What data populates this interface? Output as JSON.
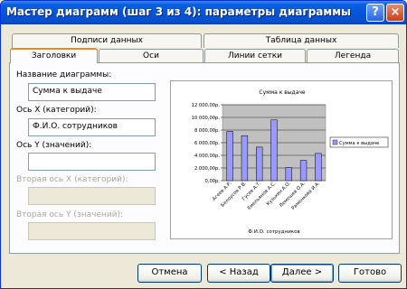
{
  "window": {
    "title": "Мастер диаграмм (шаг 3 из 4): параметры диаграммы",
    "help_label": "?",
    "close_label": "×"
  },
  "tabs": [
    {
      "label": "Подписи данных"
    },
    {
      "label": "Таблица данных"
    },
    {
      "label": "Заголовки",
      "active": true
    },
    {
      "label": "Оси"
    },
    {
      "label": "Линии сетки"
    },
    {
      "label": "Легенда"
    }
  ],
  "form": {
    "chart_title_label": "Название диаграммы:",
    "chart_title_value": "Сумма к выдаче",
    "x_axis_label": "Ось X (категорий):",
    "x_axis_value": "Ф.И.О. сотрудников",
    "y_axis_label": "Ось Y (значений):",
    "y_axis_value": "",
    "x2_axis_label": "Вторая ось X (категорий):",
    "y2_axis_label": "Вторая ось Y (значений):"
  },
  "buttons": {
    "cancel": "Отмена",
    "back": "< Назад",
    "next": "Далее >",
    "finish": "Готово"
  },
  "chart_data": {
    "type": "bar",
    "title": "Сумма к выдаче",
    "xlabel": "Ф.И.О. сотрудников",
    "ylabel": "",
    "categories": [
      "Агеев А.Р.",
      "Белоусов Р.В.",
      "Гусев А.Т.",
      "Емельянов А.С.",
      "Кузькин А.О.",
      "Лемешев О.А.",
      "Раменкова И.А."
    ],
    "series": [
      {
        "name": "Сумма к выдаче",
        "values": [
          7800,
          7100,
          5300,
          9600,
          2100,
          3200,
          4300
        ]
      }
    ],
    "ytick_labels": [
      "0,00р.",
      "2 000,00р.",
      "4 000,00р.",
      "6 000,00р.",
      "8 000,00р.",
      "10 000,00р.",
      "12 000,00р."
    ],
    "ylim": [
      0,
      12000
    ],
    "grid": true,
    "legend_position": "right",
    "colors": {
      "bar": "#9999ff",
      "plot_area": "#c0c0c0"
    }
  }
}
